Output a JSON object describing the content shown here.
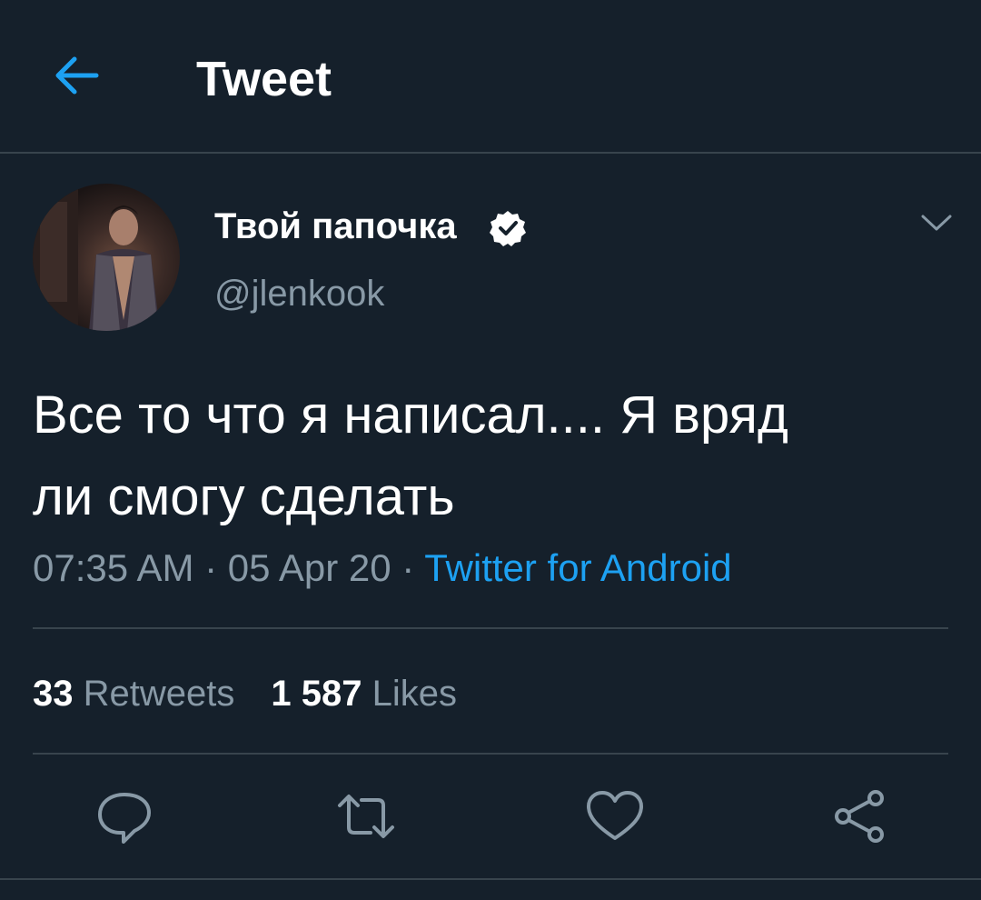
{
  "header": {
    "title": "Tweet",
    "back_icon": "arrow-left-icon"
  },
  "tweet": {
    "display_name": "Твой папочка",
    "handle": "@jlenkook",
    "verified": true,
    "text_line1": "Все то что я написал.... Я вряд",
    "text_line2": "ли смогу сделать",
    "time": "07:35 AM",
    "date": "05 Apr 20",
    "separator": " · ",
    "source": "Twitter for Android"
  },
  "stats": {
    "retweets_count": "33",
    "retweets_label": "Retweets",
    "likes_count": "1 587",
    "likes_label": "Likes"
  },
  "actions": [
    "reply-icon",
    "retweet-icon",
    "like-icon",
    "share-icon"
  ],
  "colors": {
    "background": "#15202b",
    "accent": "#1da1f2",
    "muted": "#8899a6",
    "divider": "#38444d"
  }
}
